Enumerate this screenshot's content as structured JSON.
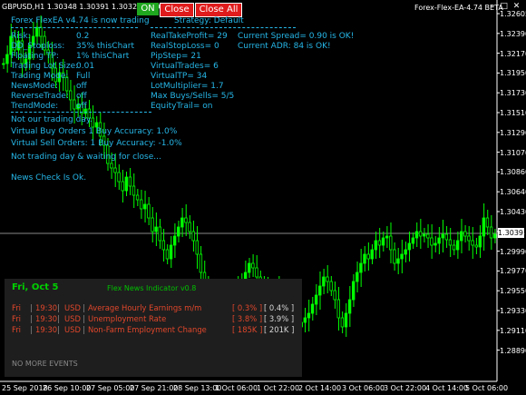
{
  "header": {
    "symbol_info": "GBPUSD,H1  1.30348 1.30391 1.30329 1.30391",
    "window_title": "Forex-Flex-EA-4.74 BETA",
    "buttons": {
      "on": "ON",
      "close": "Close",
      "close_all": "Close All"
    },
    "window_controls": {
      "minimize": "–",
      "maximize": "□",
      "close": "✕"
    }
  },
  "ea_panel": {
    "title_line": "Forex FlexEA v4.74 is now trading",
    "strategy": "Strategy: Default",
    "col1": [
      {
        "label": "Risk:",
        "value": "0.2"
      },
      {
        "label": "DD_Stoploss:",
        "value": "35%  thisChart"
      },
      {
        "label": "Floating TP:",
        "value": "1%  thisChart"
      },
      {
        "label": "Trading Lot Size:",
        "value": "0.01"
      },
      {
        "label": "Trading Mode:",
        "value": "Full"
      },
      {
        "label": "NewsMode:",
        "value": "off"
      },
      {
        "label": "ReverseTrade:",
        "value": "off"
      },
      {
        "label": "TrendMode:",
        "value": "off"
      }
    ],
    "col2": [
      "RealTakeProfit= 29",
      "RealStopLoss= 0",
      "PipStep= 21",
      "VirtualTrades= 6",
      "VirtualTP= 34",
      "LotMultiplier= 1.7",
      "Max Buys/Sells= 5/5",
      "EquityTrail= on"
    ],
    "col3": [
      "Current Spread= 0.90 is OK!",
      "Current ADR: 84  is OK!"
    ],
    "status": [
      "Not our trading day.",
      "Virtual Buy Orders 1    Buy Accuracy: 1.0%",
      "Virtual Sell Orders: 1   Buy Accuracy: -1.0%",
      "Not trading day & waiting for close...",
      "News Check Is Ok."
    ]
  },
  "news": {
    "date": "Fri, Oct 5",
    "indicator": "Flex News Indicator v0.8",
    "rows": [
      {
        "day": "Fri",
        "time": "19:30",
        "cur": "USD",
        "event": "Average Hourly Earnings m/m",
        "forecast": "[ 0.3% ]",
        "previous": "[ 0.4% ]"
      },
      {
        "day": "Fri",
        "time": "19:30",
        "cur": "USD",
        "event": "Unemployment Rate",
        "forecast": "[ 3.8% ]",
        "previous": "[ 3.9% ]"
      },
      {
        "day": "Fri",
        "time": "19:30",
        "cur": "USD",
        "event": "Non-Farm Employment Change",
        "forecast": "[ 185K ]",
        "previous": "[ 201K ]"
      }
    ],
    "footer": "NO MORE EVENTS"
  },
  "price_axis": [
    "1.32605",
    "1.32390",
    "1.32170",
    "1.31950",
    "1.31730",
    "1.31510",
    "1.31290",
    "1.31070",
    "1.30860",
    "1.30640",
    "1.30430",
    "1.30210",
    "1.29990",
    "1.29770",
    "1.29550",
    "1.29330",
    "1.29110",
    "1.28890"
  ],
  "current_price": "1.30391",
  "time_axis": [
    "25 Sep 2018",
    "26 Sep 10:00",
    "27 Sep 05:00",
    "27 Sep 21:00",
    "28 Sep 13:00",
    "1 Oct 06:00",
    "1 Oct 22:00",
    "2 Oct 14:00",
    "3 Oct 06:00",
    "3 Oct 22:00",
    "4 Oct 14:00",
    "5 Oct 06:00"
  ],
  "colors": {
    "candle": "#00ff00",
    "panel_text": "#26b7e8",
    "on_button": "#1fa81f",
    "close_button": "#e01b1b"
  }
}
